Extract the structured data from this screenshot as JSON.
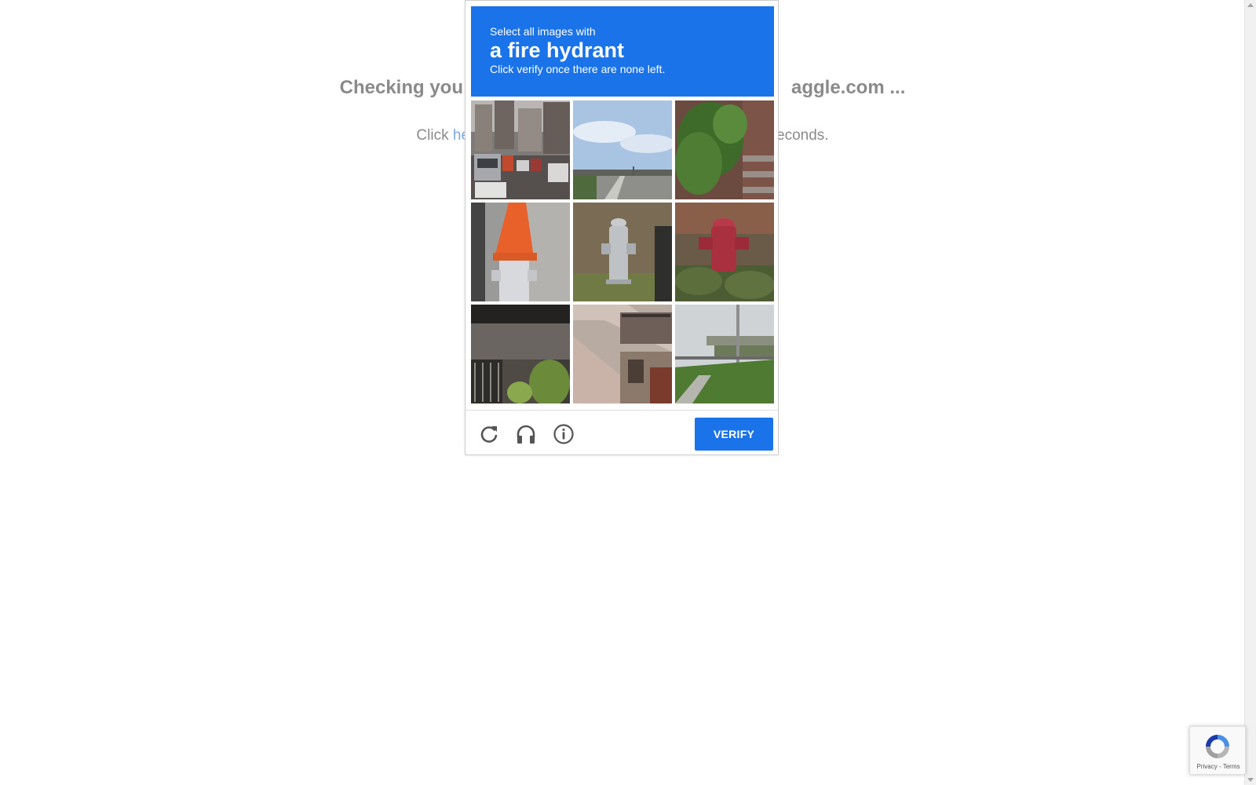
{
  "background_page": {
    "heading_left": "Checking you",
    "heading_right": "aggle.com ...",
    "sub_left": "Click ",
    "sub_link": "he",
    "sub_right": "econds."
  },
  "captcha": {
    "header": {
      "line1": "Select all images with",
      "target": "a fire hydrant",
      "line3": "Click verify once there are none left."
    },
    "tiles": [
      {
        "icon": "street-traffic-image"
      },
      {
        "icon": "highway-sky-image"
      },
      {
        "icon": "plants-stairs-image"
      },
      {
        "icon": "hydrant-with-cone-image"
      },
      {
        "icon": "silver-hydrant-image"
      },
      {
        "icon": "red-hydrant-image"
      },
      {
        "icon": "wall-fence-plants-image"
      },
      {
        "icon": "rooftops-balcony-image"
      },
      {
        "icon": "road-overpass-image"
      }
    ],
    "footer": {
      "icons": [
        "reload-icon",
        "headphones-icon",
        "info-icon"
      ],
      "verify_label": "VERIFY"
    },
    "colors": {
      "accent": "#1a73e8"
    }
  },
  "badge": {
    "privacy": "Privacy",
    "separator": " - ",
    "terms": "Terms"
  }
}
